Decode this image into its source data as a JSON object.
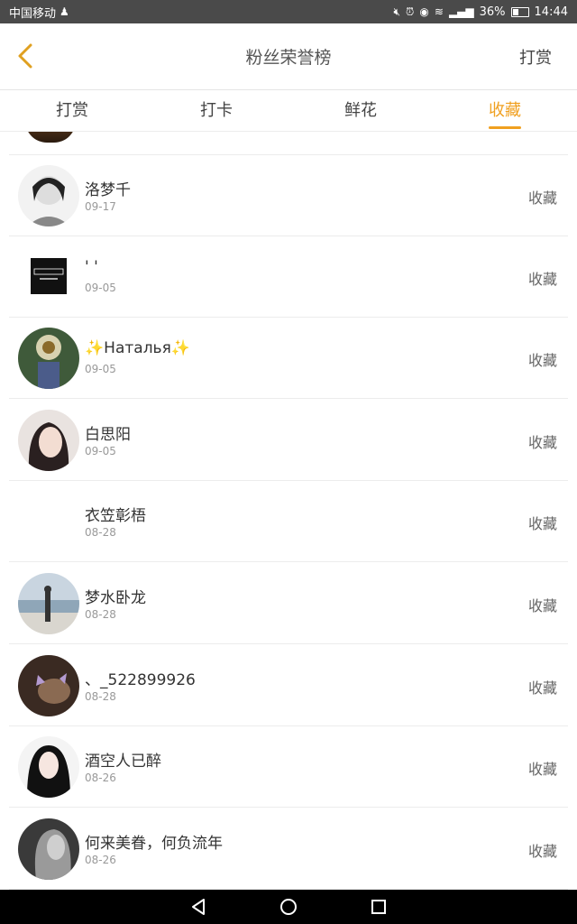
{
  "status": {
    "carrier": "中国移动",
    "battery": "36%",
    "time": "14:44"
  },
  "header": {
    "title": "粉丝荣誉榜",
    "reward_label": "打赏"
  },
  "tabs": [
    {
      "label": "打赏"
    },
    {
      "label": "打卡"
    },
    {
      "label": "鲜花"
    },
    {
      "label": "收藏",
      "active": true
    }
  ],
  "rows": [
    {
      "name": "洛梦千",
      "date": "09-17",
      "action": "收藏",
      "avatar": "sketch-avatar"
    },
    {
      "name": "' '",
      "date": "09-05",
      "action": "收藏",
      "avatar": "dark-square-avatar"
    },
    {
      "name": "Наталья",
      "date": "09-05",
      "action": "收藏",
      "avatar": "sunflower-avatar"
    },
    {
      "name": "白思阳",
      "date": "09-05",
      "action": "收藏",
      "avatar": "girl-portrait-avatar"
    },
    {
      "name": "衣笠彰梧",
      "date": "08-28",
      "action": "收藏",
      "avatar": "blank-avatar"
    },
    {
      "name": "梦水卧龙",
      "date": "08-28",
      "action": "收藏",
      "avatar": "beach-avatar"
    },
    {
      "name": "、_522899926",
      "date": "08-28",
      "action": "收藏",
      "avatar": "cat-avatar"
    },
    {
      "name": "酒空人已醉",
      "date": "08-26",
      "action": "收藏",
      "avatar": "dark-hair-avatar"
    },
    {
      "name": "何来美眷，何负流年",
      "date": "08-26",
      "action": "收藏",
      "avatar": "gray-portrait-avatar"
    }
  ],
  "colors": {
    "accent": "#f0a020",
    "status_bar": "#4a4a4a"
  }
}
